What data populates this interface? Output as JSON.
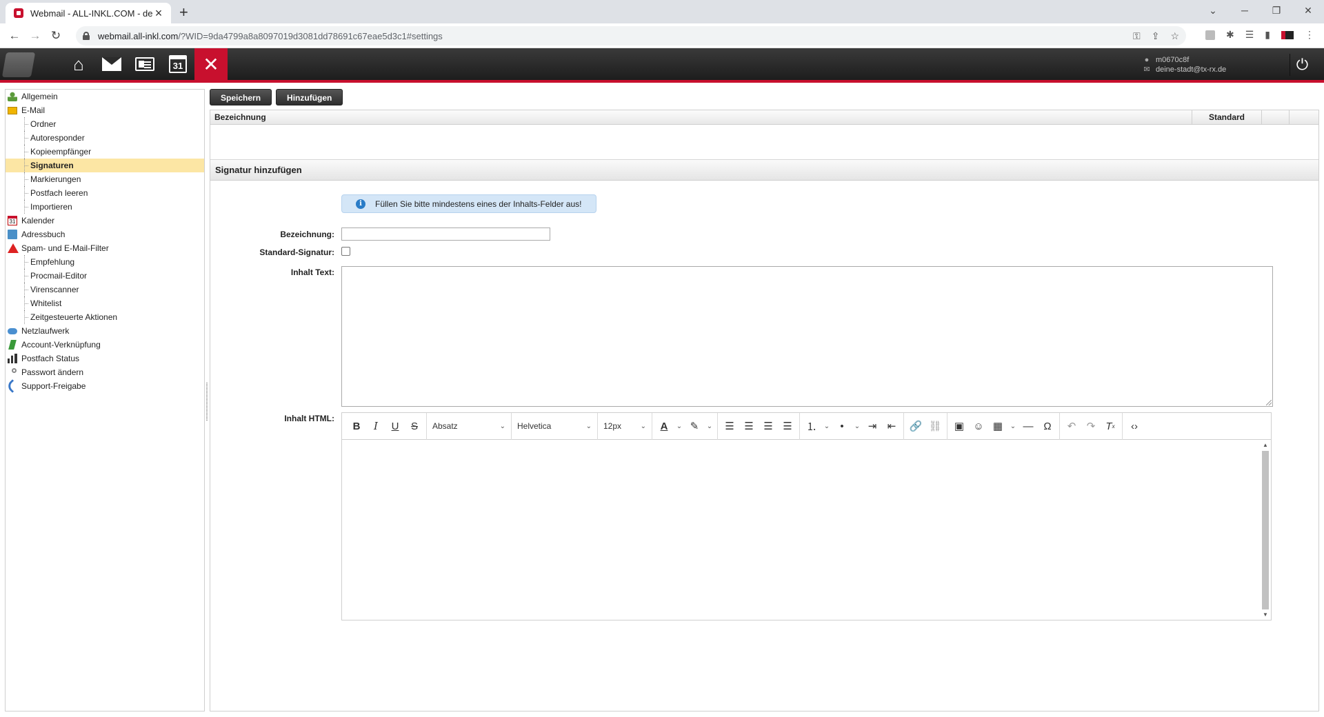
{
  "browser": {
    "tab_title": "Webmail - ALL-INKL.COM - deine",
    "url_host": "webmail.all-inkl.com",
    "url_path": "/?WID=9da4799a8a8097019d3081dd78691c67eae5d3c1#settings"
  },
  "app": {
    "nav": [
      "home-icon",
      "mail-icon",
      "addressbook-icon",
      "calendar-icon",
      "settings-icon"
    ],
    "calendar_day": "31",
    "user_name": "m0670c8f",
    "user_email": "deine-stadt@tx-rx.de",
    "accent_color": "#c8102e"
  },
  "sidebar": {
    "items": [
      {
        "label": "Allgemein",
        "level": 0,
        "icon": "user-icon"
      },
      {
        "label": "E-Mail",
        "level": 0,
        "icon": "mail-icon"
      },
      {
        "label": "Ordner",
        "level": 1
      },
      {
        "label": "Autoresponder",
        "level": 1
      },
      {
        "label": "Kopieempfänger",
        "level": 1
      },
      {
        "label": "Signaturen",
        "level": 1,
        "selected": true
      },
      {
        "label": "Markierungen",
        "level": 1
      },
      {
        "label": "Postfach leeren",
        "level": 1
      },
      {
        "label": "Importieren",
        "level": 1
      },
      {
        "label": "Kalender",
        "level": 0,
        "icon": "calendar-icon"
      },
      {
        "label": "Adressbuch",
        "level": 0,
        "icon": "addressbook-icon"
      },
      {
        "label": "Spam- und E-Mail-Filter",
        "level": 0,
        "icon": "warning-icon"
      },
      {
        "label": "Empfehlung",
        "level": 1
      },
      {
        "label": "Procmail-Editor",
        "level": 1
      },
      {
        "label": "Virenscanner",
        "level": 1
      },
      {
        "label": "Whitelist",
        "level": 1
      },
      {
        "label": "Zeitgesteuerte Aktionen",
        "level": 1
      },
      {
        "label": "Netzlaufwerk",
        "level": 0,
        "icon": "cloud-icon"
      },
      {
        "label": "Account-Verknüpfung",
        "level": 0,
        "icon": "link-icon"
      },
      {
        "label": "Postfach Status",
        "level": 0,
        "icon": "bar-chart-icon"
      },
      {
        "label": "Passwort ändern",
        "level": 0,
        "icon": "key-icon"
      },
      {
        "label": "Support-Freigabe",
        "level": 0,
        "icon": "phone-icon"
      }
    ]
  },
  "toolbar": {
    "save_label": "Speichern",
    "add_label": "Hinzufügen"
  },
  "list": {
    "col_name": "Bezeichnung",
    "col_standard": "Standard"
  },
  "form": {
    "section_title": "Signatur hinzufügen",
    "info_message": "Füllen Sie bitte mindestens eines der Inhalts-Felder aus!",
    "label_name": "Bezeichnung:",
    "label_default": "Standard-Signatur:",
    "label_text": "Inhalt Text:",
    "label_html": "Inhalt HTML:",
    "name_value": "",
    "default_checked": false,
    "text_value": ""
  },
  "editor": {
    "block_format": "Absatz",
    "font_family": "Helvetica",
    "font_size": "12px"
  }
}
